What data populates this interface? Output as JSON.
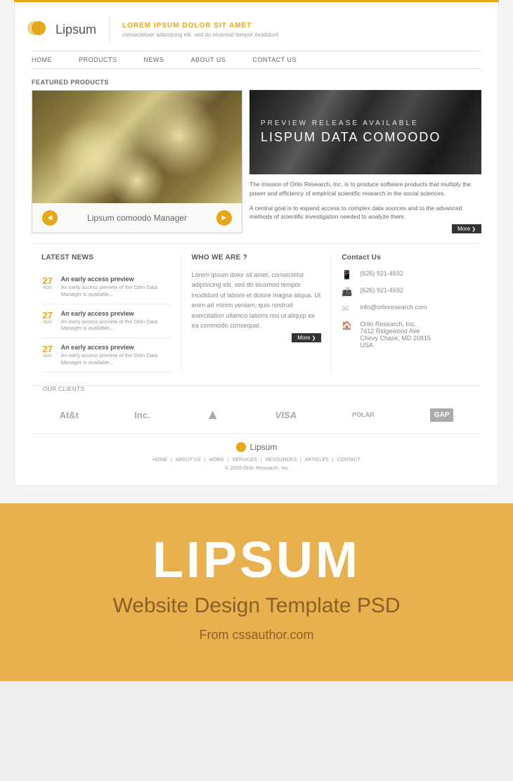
{
  "header": {
    "brand": "Lipsum",
    "tagline_title": "LOREM IPSUM DOLOR SIT AMET",
    "tagline_sub": "consectetuer adipisicing elit, sed do eiusmod tempor incididunt"
  },
  "nav": [
    "HOME",
    "PRODUCTS",
    "NEWS",
    "ABOUT US",
    "CONTACT US"
  ],
  "featured": {
    "label": "FEATURED PRODUCTS",
    "left_caption": "Lipsum comoodo Manager",
    "right_sub": "PREVIEW RELEASE AVAILABLE",
    "right_main": "LISPUM DATA COMOODO",
    "right_desc1": "The mission of Orlin Research, Inc. is to produce software products that multiply the power and efficiency of empirical scientific research in the social sciences.",
    "right_desc2": "A central goal is to expand access to complex data sources and to the advanced methods of scientific investigation needed to analyze them.",
    "more": "More"
  },
  "news": {
    "title": "LATEST NEWS",
    "items": [
      {
        "day": "27",
        "mon": "NOV",
        "title": "An early access preview",
        "desc": "An early access preview of the Orlin Data Manager is available..."
      },
      {
        "day": "27",
        "mon": "NOV",
        "title": "An early access preview",
        "desc": "An early access preview of the Orlin Data Manager is available..."
      },
      {
        "day": "27",
        "mon": "NOV",
        "title": "An early access preview",
        "desc": "An early access preview of the Orlin Data Manager is available..."
      }
    ]
  },
  "who": {
    "title": "WHO WE ARE ?",
    "body": "Lorem ipsum dolor sit amet, consectetur adipisicing elit, sed do eiusmod tempor incididunt ut labore et dolore magna aliqua. Ut enim ad minim veniam, quis nostrud exercitation ullamco laboris nisi ut aliquip ex ea commodo consequat.",
    "more": "More"
  },
  "contact": {
    "title": "Contact Us",
    "phone": "(626) 921-4592",
    "fax": "(626) 921-4592",
    "email": "info@orlinresearch.com",
    "addr1": "Orlin Research, Inc.",
    "addr2": "7412 Ridgewood Ave",
    "addr3": "Chevy Chase, MD 20815",
    "addr4": "USA"
  },
  "clients": {
    "label": "OUR CLIENTS",
    "logos": [
      "At&t",
      "Inc.",
      "▲",
      "VISA",
      "POLAR",
      "GAP"
    ]
  },
  "footer": {
    "brand": "Lipsum",
    "links": [
      "HOME",
      "ABOUT US",
      "WORK",
      "SERVICES",
      "RESOURCES",
      "ARTICLES",
      "CONTACT"
    ],
    "copy": "© 2009 Orlin Research, Inc"
  },
  "promo": {
    "title": "LIPSUM",
    "subtitle": "Website Design Template PSD",
    "source": "From cssauthor.com"
  }
}
